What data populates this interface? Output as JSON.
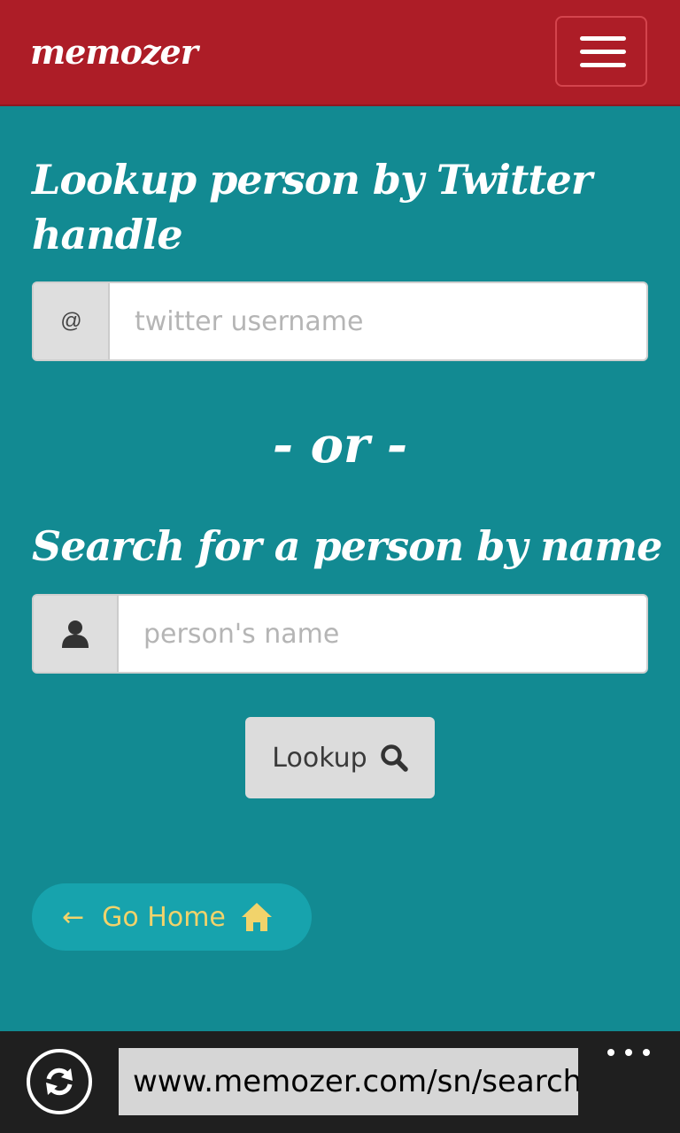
{
  "navbar": {
    "brand": "memozer",
    "menu_icon": "hamburger-menu-icon"
  },
  "twitter_lookup": {
    "heading": "Lookup person by Twitter handle",
    "addon": "@",
    "placeholder": "twitter username",
    "value": ""
  },
  "divider": {
    "label": "- or -"
  },
  "name_search": {
    "heading": "Search for a person by name",
    "addon_icon": "user-icon",
    "placeholder": "person's name",
    "value": ""
  },
  "lookup_button": {
    "label": "Lookup",
    "icon": "search-icon"
  },
  "home_button": {
    "arrow": "←",
    "label": "Go Home",
    "icon": "home-icon"
  },
  "browser": {
    "refresh_icon": "refresh-icon",
    "url": "www.memozer.com/sn/search",
    "more_icon": "more-options-icon"
  },
  "colors": {
    "navbar": "#ad1d27",
    "page_background": "#128a92",
    "home_button_background": "#17a3ad",
    "home_button_text": "#f1d36b",
    "browser_bar": "#1f1f1f"
  }
}
